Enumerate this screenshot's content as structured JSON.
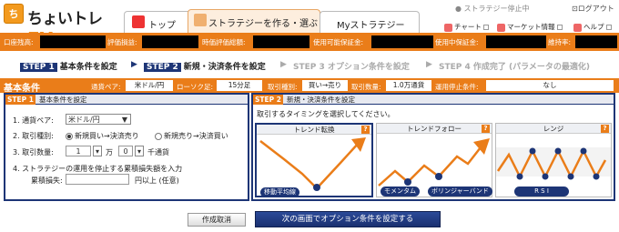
{
  "header": {
    "logo_mark": "ち",
    "logo_text": "ちょいトレ",
    "logo_fx": "FX",
    "nav": {
      "top": "トップ",
      "create": "ストラテジーを作る・選ぶ",
      "my": "Myストラテジー"
    },
    "stop_notice": "ストラテジー停止中",
    "logout": "ログアウト",
    "links": {
      "chart": "チャート",
      "market": "マーケット情報",
      "help": "ヘルプ"
    }
  },
  "account": {
    "labels": [
      "口座残高:",
      "評価損益:",
      "時価評価総額:",
      "使用可能保証金:",
      "使用中保証金:",
      "維持率:"
    ]
  },
  "steps": [
    {
      "badge": "STEP 1",
      "label": "基本条件を設定"
    },
    {
      "badge": "STEP 2",
      "label": "新規・決済条件を設定"
    },
    {
      "label": "STEP 3 オプション条件を設定"
    },
    {
      "label": "STEP 4 作成完了 (パラメータの最適化)"
    }
  ],
  "summary": {
    "title": "基本条件",
    "pair_label": "通貨ペア:",
    "pair_value": "米ドル/円",
    "candle_label": "ローソク足:",
    "candle_value": "15分足",
    "type_label": "取引種別:",
    "type_value": "買い→売り",
    "qty_label": "取引数量:",
    "qty_value": "1.0万通貨",
    "stop_label": "運用停止条件:",
    "stop_value": "なし"
  },
  "step1": {
    "badge": "STEP 1",
    "title": "基本条件を設定",
    "pair_label": "1. 通貨ペア:",
    "pair_value": "米ドル/円",
    "type_label": "2. 取引種別:",
    "buy_sell": "新規買い→決済売り",
    "sell_buy": "新規売り→決済買い",
    "qty_label": "3. 取引数量:",
    "qty_value": "1",
    "man": "万",
    "sen_value": "0",
    "sen": "千通貨",
    "stop_label": "4. ストラテジーの運用を停止する累積損失額を入力",
    "loss_label": "累積損失:",
    "loss_unit": "円以上 (任意)"
  },
  "step2": {
    "badge": "STEP 2",
    "title": "新規・決済条件を設定",
    "instruction": "取引するタイミングを選択してください。",
    "cards": [
      {
        "title": "トレンド転換",
        "tags": [
          "移動平均線"
        ]
      },
      {
        "title": "トレンドフォロー",
        "tags": [
          "モメンタム",
          "ボリンジャーバンド"
        ]
      },
      {
        "title": "レンジ",
        "tags": [
          "R S I"
        ]
      }
    ],
    "q": "?"
  },
  "buttons": {
    "cancel": "作成取消",
    "next": "次の画面でオプション条件を設定する"
  },
  "colors": {
    "orange": "#ea7d19",
    "navy": "#1d3576"
  }
}
